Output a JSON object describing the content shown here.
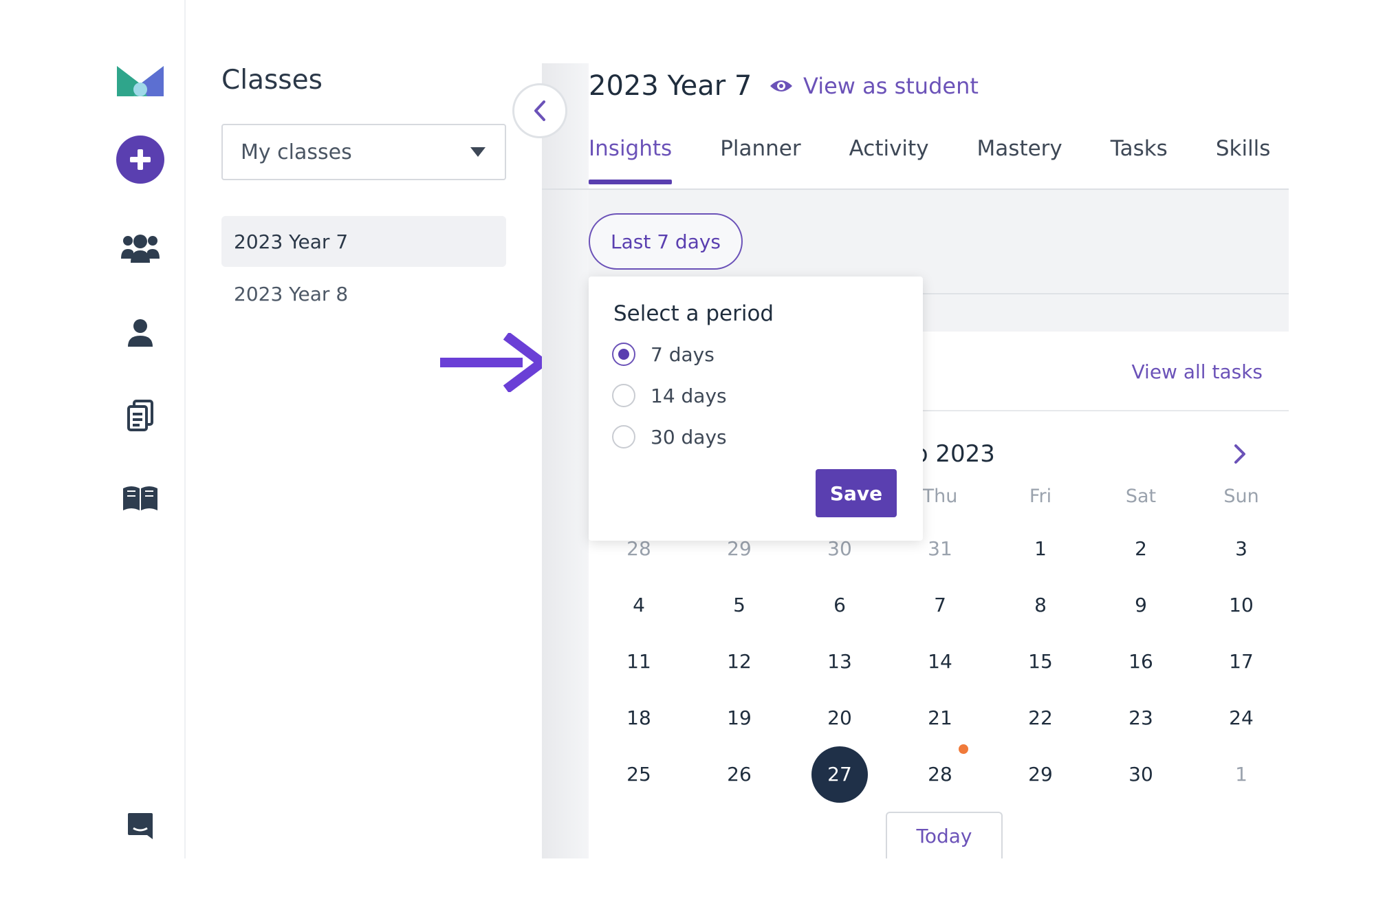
{
  "colors": {
    "accent": "#5a3fb0",
    "accent_text": "#6b52b8",
    "today_bg": "#1f3048",
    "dot": "#f07a3a"
  },
  "rail": {
    "icons": [
      "app-logo-icon",
      "add-icon",
      "classes-group-icon",
      "student-icon",
      "tasks-document-icon",
      "library-book-icon",
      "chat-icon"
    ]
  },
  "classes": {
    "title": "Classes",
    "filter_value": "My classes",
    "items": [
      {
        "label": "2023 Year 7",
        "active": true
      },
      {
        "label": "2023 Year 8",
        "active": false
      }
    ]
  },
  "header": {
    "title": "2023 Year 7",
    "view_as_student": "View as student"
  },
  "tabs": [
    "Insights",
    "Planner",
    "Activity",
    "Mastery",
    "Tasks",
    "Skills"
  ],
  "period_pill": "Last 7 days",
  "popover": {
    "title": "Select a period",
    "options": [
      {
        "label": "7 days",
        "checked": true
      },
      {
        "label": "14 days",
        "checked": false
      },
      {
        "label": "30 days",
        "checked": false
      }
    ],
    "save_label": "Save"
  },
  "tasks": {
    "view_all": "View all tasks"
  },
  "calendar": {
    "month_label": "p 2023",
    "weekday_headers": [
      "Thu",
      "Fri",
      "Sat",
      "Sun"
    ],
    "weeks": [
      [
        "28",
        "29",
        "30",
        "31",
        "1",
        "2",
        "3"
      ],
      [
        "4",
        "5",
        "6",
        "7",
        "8",
        "9",
        "10"
      ],
      [
        "11",
        "12",
        "13",
        "14",
        "15",
        "16",
        "17"
      ],
      [
        "18",
        "19",
        "20",
        "21",
        "22",
        "23",
        "24"
      ],
      [
        "25",
        "26",
        "27",
        "28",
        "29",
        "30",
        "1"
      ]
    ],
    "today_label": "Today"
  }
}
